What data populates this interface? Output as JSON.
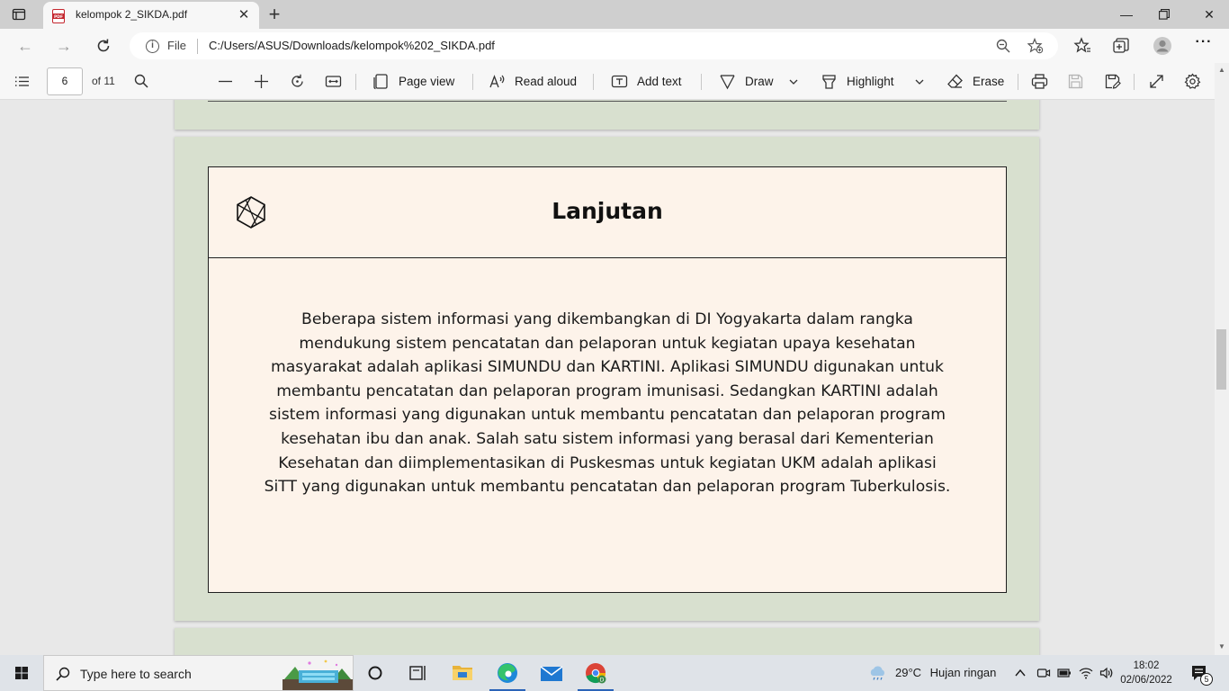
{
  "browser": {
    "tab_title": "kelompok 2_SIKDA.pdf",
    "scheme_label": "File",
    "url": "C:/Users/ASUS/Downloads/kelompok%202_SIKDA.pdf"
  },
  "pdf_toolbar": {
    "page_current": "6",
    "page_total": "of 11",
    "page_view": "Page view",
    "read_aloud": "Read aloud",
    "add_text": "Add text",
    "draw": "Draw",
    "highlight": "Highlight",
    "erase": "Erase"
  },
  "document": {
    "title": "Lanjutan",
    "body": "Beberapa sistem informasi yang dikembangkan di DI Yogyakarta dalam rangka mendukung sistem pencatatan dan pelaporan untuk kegiatan upaya kesehatan masyarakat adalah aplikasi SIMUNDU dan KARTINI. Aplikasi SIMUNDU digunakan untuk membantu pencatatan dan pelaporan program imunisasi. Sedangkan KARTINI adalah sistem informasi yang digunakan untuk membantu pencatatan dan pelaporan program kesehatan ibu dan anak. Salah satu sistem informasi yang berasal dari Kementerian Kesehatan dan diimplementasikan di Puskesmas untuk kegiatan UKM adalah aplikasi SiTT yang digunakan untuk membantu pencatatan dan pelaporan program Tuberkulosis.",
    "body_lines": [
      "Beberapa sistem informasi yang dikembangkan di DI Yogyakarta dalam rangka",
      "mendukung sistem pencatatan dan pelaporan untuk kegiatan upaya kesehatan",
      "masyarakat adalah aplikasi SIMUNDU dan KARTINI. Aplikasi SIMUNDU digunakan untuk",
      "membantu pencatatan dan pelaporan program imunisasi. Sedangkan KARTINI adalah",
      "sistem informasi yang digunakan untuk membantu pencatatan dan pelaporan program",
      "kesehatan ibu dan anak. Salah satu sistem informasi yang berasal dari Kementerian",
      "Kesehatan dan diimplementasikan di Puskesmas untuk kegiatan UKM adalah aplikasi",
      "SiTT yang digunakan untuk membantu pencatatan dan pelaporan program Tuberkulosis."
    ]
  },
  "taskbar": {
    "search_placeholder": "Type here to search",
    "weather_temp": "29°C",
    "weather_desc": "Hujan ringan",
    "time": "18:02",
    "date": "02/06/2022",
    "notification_count": "5"
  },
  "colors": {
    "page_bg": "#d8e0cf",
    "card_bg": "#fdf3ea",
    "taskbar_bg": "#dfe3e8"
  }
}
